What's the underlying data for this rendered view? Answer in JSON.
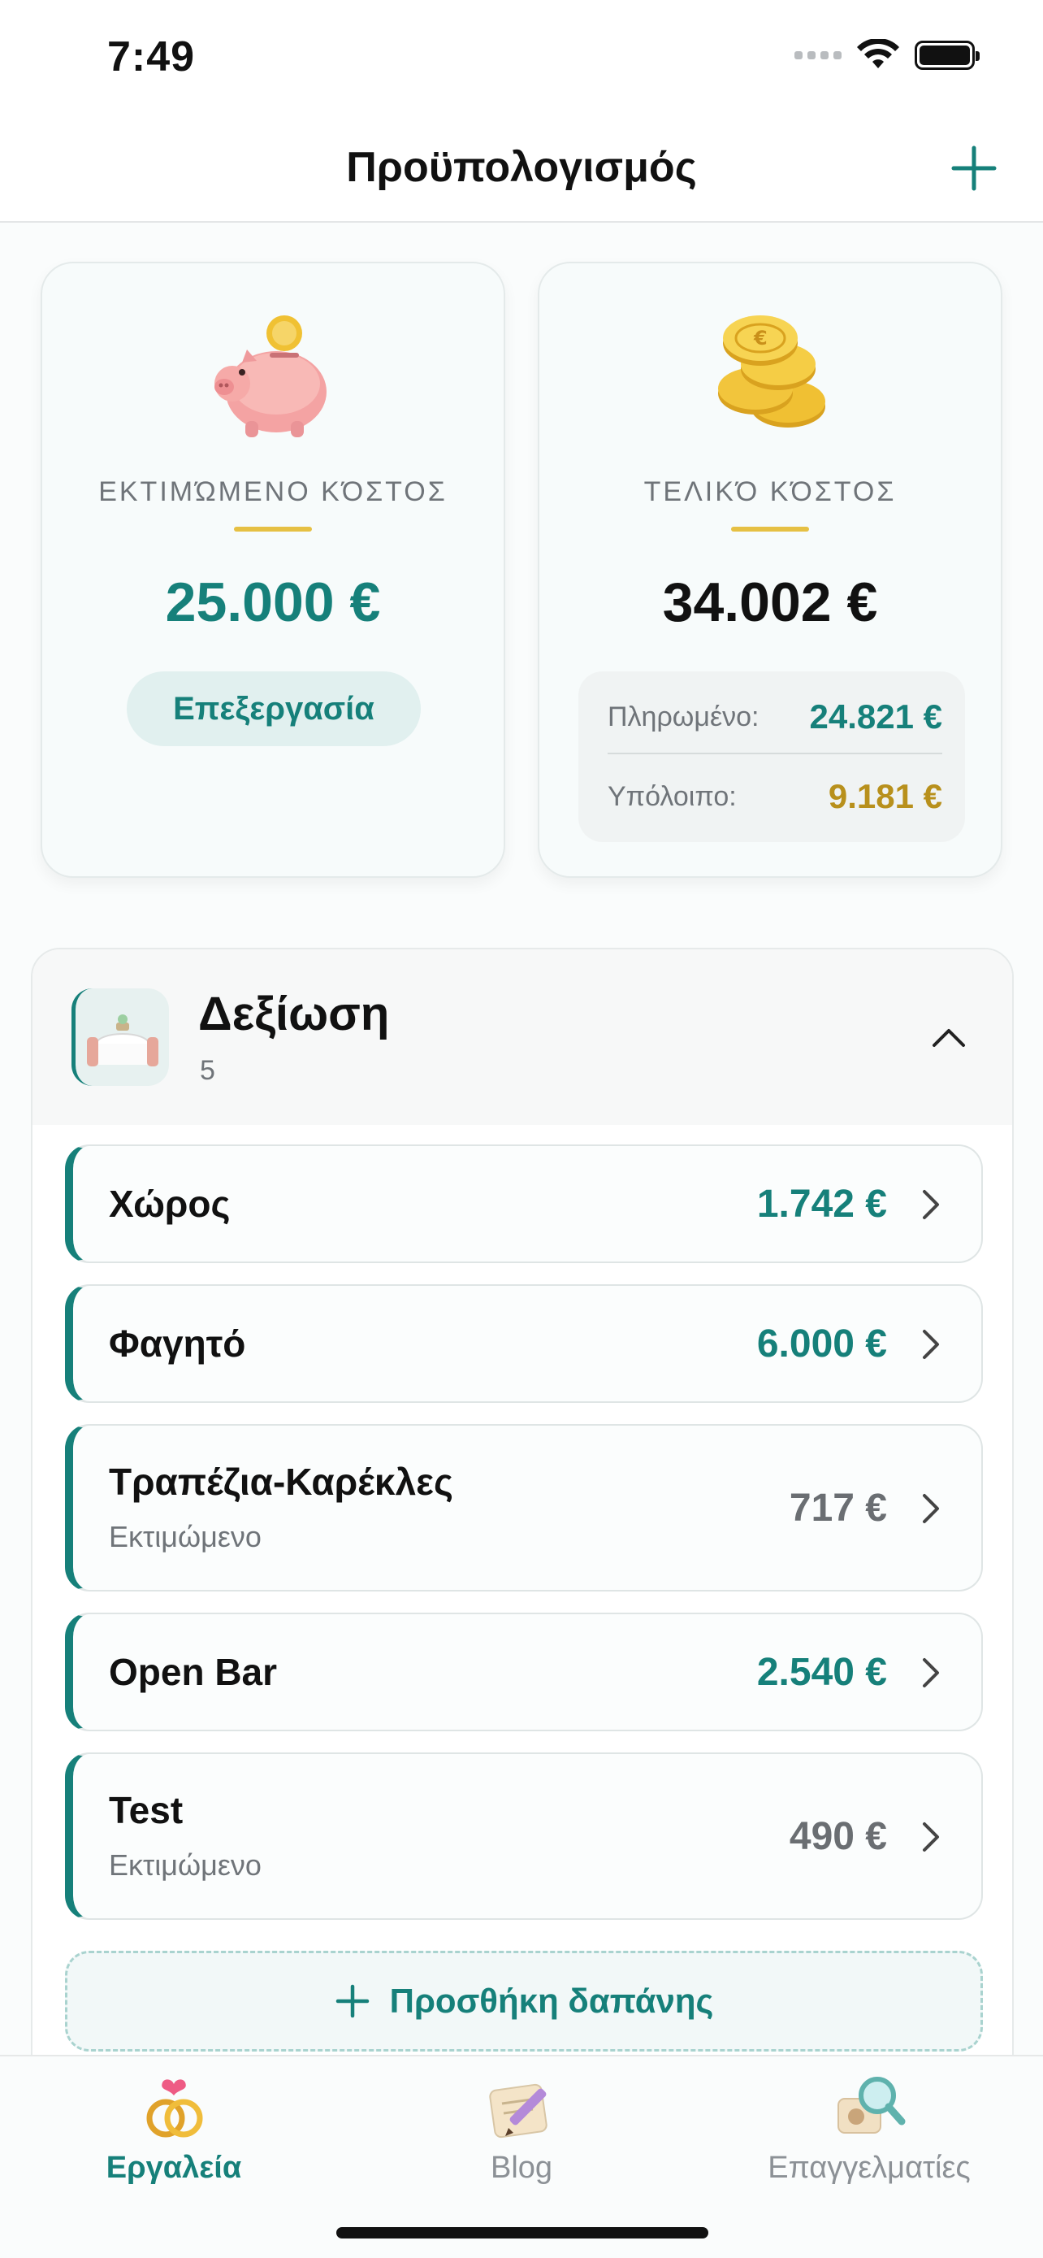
{
  "status_bar": {
    "time": "7:49"
  },
  "nav": {
    "title": "Προϋπολογισμός",
    "add_icon": "plus-icon"
  },
  "estimated": {
    "label": "ΕΚΤΙΜΏΜΕΝΟ ΚΌΣΤΟΣ",
    "amount": "25.000 €",
    "edit_label": "Επεξεργασία",
    "icon": "piggy-bank-icon"
  },
  "final": {
    "label": "ΤΕΛΙΚΌ ΚΌΣΤΟΣ",
    "amount": "34.002 €",
    "icon": "coins-icon",
    "paid_label": "Πληρωμένο:",
    "paid_value": "24.821 €",
    "remaining_label": "Υπόλοιπο:",
    "remaining_value": "9.181 €"
  },
  "category": {
    "title": "Δεξίωση",
    "count": "5",
    "icon": "reception-table-icon",
    "items": [
      {
        "name": "Χώρος",
        "subtitle": "",
        "amount": "1.742 €",
        "status": "final"
      },
      {
        "name": "Φαγητό",
        "subtitle": "",
        "amount": "6.000 €",
        "status": "final"
      },
      {
        "name": "Τραπέζια-Καρέκλες",
        "subtitle": "Εκτιμώμενο",
        "amount": "717 €",
        "status": "estimated"
      },
      {
        "name": "Open Bar",
        "subtitle": "",
        "amount": "2.540 €",
        "status": "final"
      },
      {
        "name": "Test",
        "subtitle": "Εκτιμώμενο",
        "amount": "490 €",
        "status": "estimated"
      }
    ],
    "add_label": "Προσθήκη δαπάνης"
  },
  "tabs": [
    {
      "label": "Εργαλεία",
      "icon": "wedding-rings-icon",
      "active": true
    },
    {
      "label": "Blog",
      "icon": "notepad-pencil-icon",
      "active": false
    },
    {
      "label": "Επαγγελματίες",
      "icon": "magnifier-photo-icon",
      "active": false
    }
  ],
  "colors": {
    "accent": "#16807a",
    "gold": "#b8901c",
    "accent_soft": "#e1f0ef"
  }
}
